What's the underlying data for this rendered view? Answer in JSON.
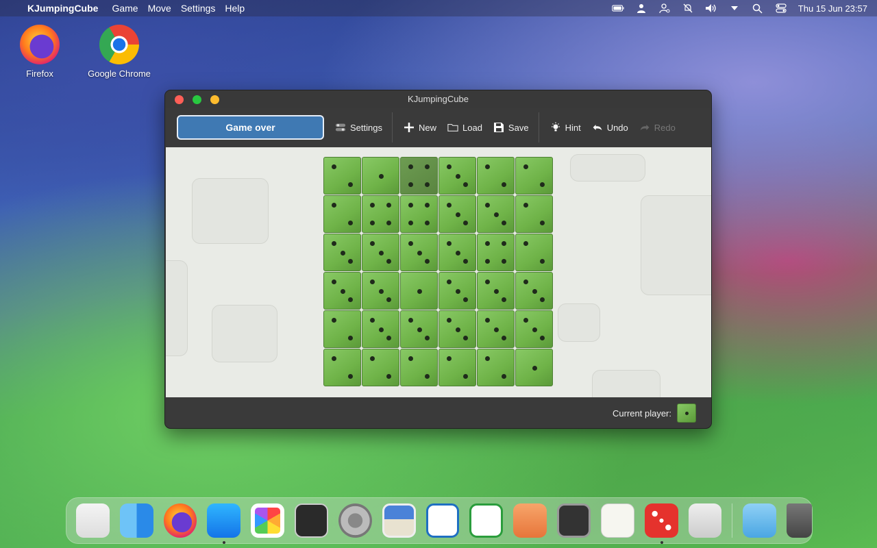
{
  "menubar": {
    "app_name": "KJumpingCube",
    "menus": [
      "Game",
      "Move",
      "Settings",
      "Help"
    ],
    "clock": "Thu 15 Jun 23:57"
  },
  "desktop": {
    "icons": [
      {
        "label": "Firefox",
        "icon": "firefox-icon"
      },
      {
        "label": "Google Chrome",
        "icon": "chrome-icon"
      }
    ]
  },
  "window": {
    "title": "KJumpingCube",
    "toolbar": {
      "status_label": "Game over",
      "settings_label": "Settings",
      "new_label": "New",
      "load_label": "Load",
      "save_label": "Save",
      "hint_label": "Hint",
      "undo_label": "Undo",
      "redo_label": "Redo"
    },
    "board": {
      "rows": 6,
      "cols": 6,
      "cells": [
        [
          2,
          1,
          4,
          3,
          2,
          2
        ],
        [
          2,
          4,
          4,
          3,
          3,
          2
        ],
        [
          3,
          3,
          3,
          3,
          4,
          2
        ],
        [
          3,
          3,
          1,
          3,
          3,
          3
        ],
        [
          2,
          3,
          3,
          3,
          3,
          3
        ],
        [
          2,
          2,
          2,
          2,
          2,
          1
        ]
      ],
      "highlighted_cell": [
        0,
        2
      ]
    },
    "statusbar": {
      "current_player_label": "Current player:"
    }
  },
  "dock": {
    "items": [
      {
        "name": "launchpad-icon",
        "running": false
      },
      {
        "name": "finder-icon",
        "running": false
      },
      {
        "name": "firefox-icon",
        "running": false
      },
      {
        "name": "app-store-icon",
        "running": true
      },
      {
        "name": "photos-icon",
        "running": false
      },
      {
        "name": "terminal-icon",
        "running": false
      },
      {
        "name": "system-settings-icon",
        "running": false
      },
      {
        "name": "image-viewer-icon",
        "running": false
      },
      {
        "name": "writer-icon",
        "running": false
      },
      {
        "name": "spreadsheet-icon",
        "running": false
      },
      {
        "name": "draw-icon",
        "running": false
      },
      {
        "name": "cassette-icon",
        "running": false
      },
      {
        "name": "text-editor-icon",
        "running": false
      },
      {
        "name": "kjumpingcube-icon",
        "running": true
      },
      {
        "name": "calculator-icon",
        "running": false
      },
      {
        "name": "downloads-folder-icon",
        "running": false
      },
      {
        "name": "trash-icon",
        "running": false
      }
    ]
  }
}
